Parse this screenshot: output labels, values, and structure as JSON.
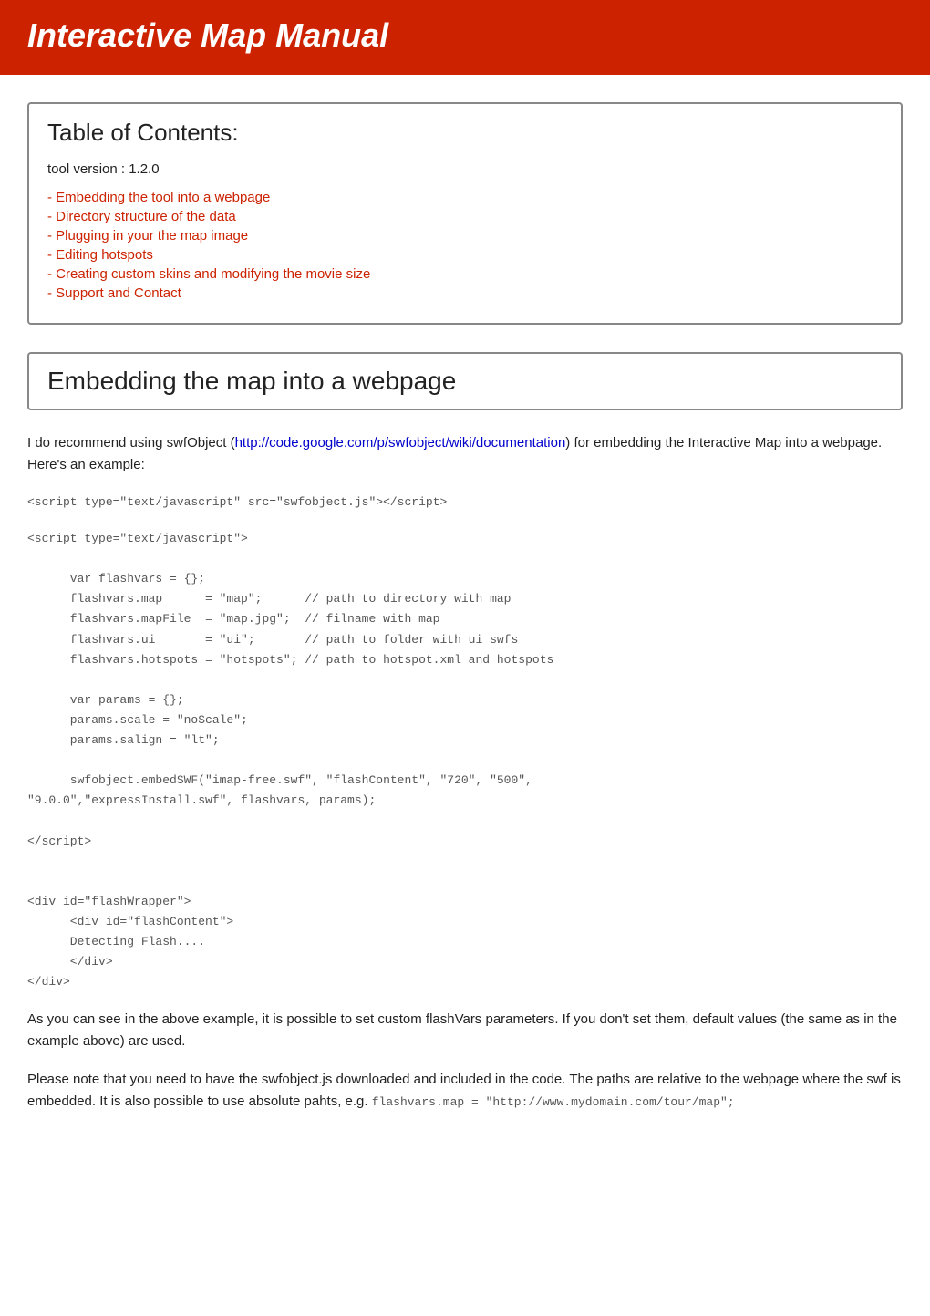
{
  "header": {
    "title": "Interactive Map Manual"
  },
  "toc": {
    "heading": "Table of Contents:",
    "version_label": "tool version : 1.2.0",
    "items": [
      {
        "label": "- Embedding the tool into a webpage",
        "href": "#embedding"
      },
      {
        "label": "- Directory structure of the data",
        "href": "#directory"
      },
      {
        "label": "- Plugging in your the map image",
        "href": "#map-image"
      },
      {
        "label": "- Editing hotspots",
        "href": "#hotspots"
      },
      {
        "label": "- Creating custom skins and modifying the movie size",
        "href": "#skins"
      },
      {
        "label": "- Support and Contact",
        "href": "#support"
      }
    ]
  },
  "embedding_section": {
    "heading": "Embedding the map into a webpage",
    "intro_text": "I do recommend using swfObject (",
    "swf_link": "http://code.google.com/p/swfobject/wiki/documentation",
    "intro_text2": ") for embedding the Interactive Map into a webpage. Here's an example:",
    "code1": "<script type=\"text/javascript\" src=\"swfobject.js\"></script>",
    "code2": "<script type=\"text/javascript\">",
    "code3": "      var flashvars = {};\n      flashvars.map      = \"map\";      // path to directory with map\n      flashvars.mapFile  = \"map.jpg\";  // filname with map\n      flashvars.ui       = \"ui\";       // path to folder with ui swfs\n      flashvars.hotspots = \"hotspots\"; // path to hotspot.xml and hotspots\n\n      var params = {};\n      params.scale = \"noScale\";\n      params.salign = \"lt\";\n\n      swfobject.embedSWF(\"imap-free.swf\", \"flashContent\", \"720\", \"500\",\n\"9.0.0\",\"expressInstall.swf\", flashvars, params);",
    "code4": "</script>",
    "code5": "",
    "code6": "<div id=\"flashWrapper\">\n      <div id=\"flashContent\">\n      Detecting Flash....\n      </div>\n</div>",
    "outro1": "As you can see in the above example, it is possible to set custom flashVars parameters. If you don't set them, default values (the same as in the example above) are used.",
    "outro2_start": "Please note that you need to have the swfobject.js downloaded and included in the code. The paths are relative to the webpage where the swf is embedded. It is also possible to use absolute pahts, e.g. ",
    "outro2_code": "flashvars.map = \"http://www.mydomain.com/tour/map\";"
  }
}
